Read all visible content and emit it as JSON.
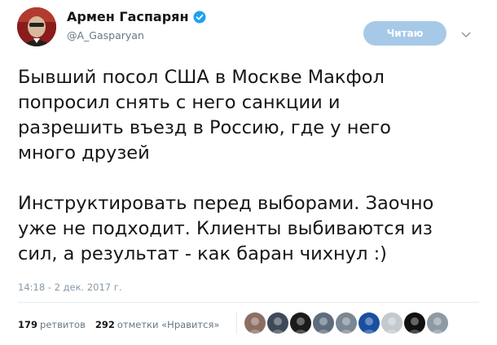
{
  "author": {
    "name": "Армен Гаспарян",
    "handle": "@A_Gasparyan",
    "verified": true
  },
  "follow_button": {
    "label": "Читаю",
    "color": "#a7c9e8"
  },
  "tweet": {
    "text": "Бывший посол США в Москве Макфол\nпопросил снять с него санкции и\nразрешить въезд в Россию, где у него\nмного друзей\n\nИнструктировать перед выборами. Заочно\nуже не подходит. Клиенты выбиваются из\nсил, а результат - как баран чихнул :)",
    "timestamp": "14:18 - 2 дек. 2017 г."
  },
  "stats": {
    "retweets_count": "179",
    "retweets_label": "ретвитов",
    "likes_count": "292",
    "likes_label": "отметки «Нравится»"
  },
  "liker_avatars": [
    {
      "name": "liker-avatar-1",
      "color": "#8d6e63"
    },
    {
      "name": "liker-avatar-2",
      "color": "#3e4a5a"
    },
    {
      "name": "liker-avatar-3",
      "color": "#1b1b1b"
    },
    {
      "name": "liker-avatar-4",
      "color": "#5d6d7e"
    },
    {
      "name": "liker-avatar-5",
      "color": "#7a8894"
    },
    {
      "name": "liker-avatar-6",
      "color": "#1a4fa0"
    },
    {
      "name": "liker-avatar-7",
      "color": "#c4c9ce"
    },
    {
      "name": "liker-avatar-8",
      "color": "#111111"
    },
    {
      "name": "liker-avatar-9",
      "color": "#8e9aa3"
    }
  ],
  "colors": {
    "verified_badge": "#1da1f2",
    "secondary_text": "#657786",
    "divider": "#e6ecf0"
  }
}
